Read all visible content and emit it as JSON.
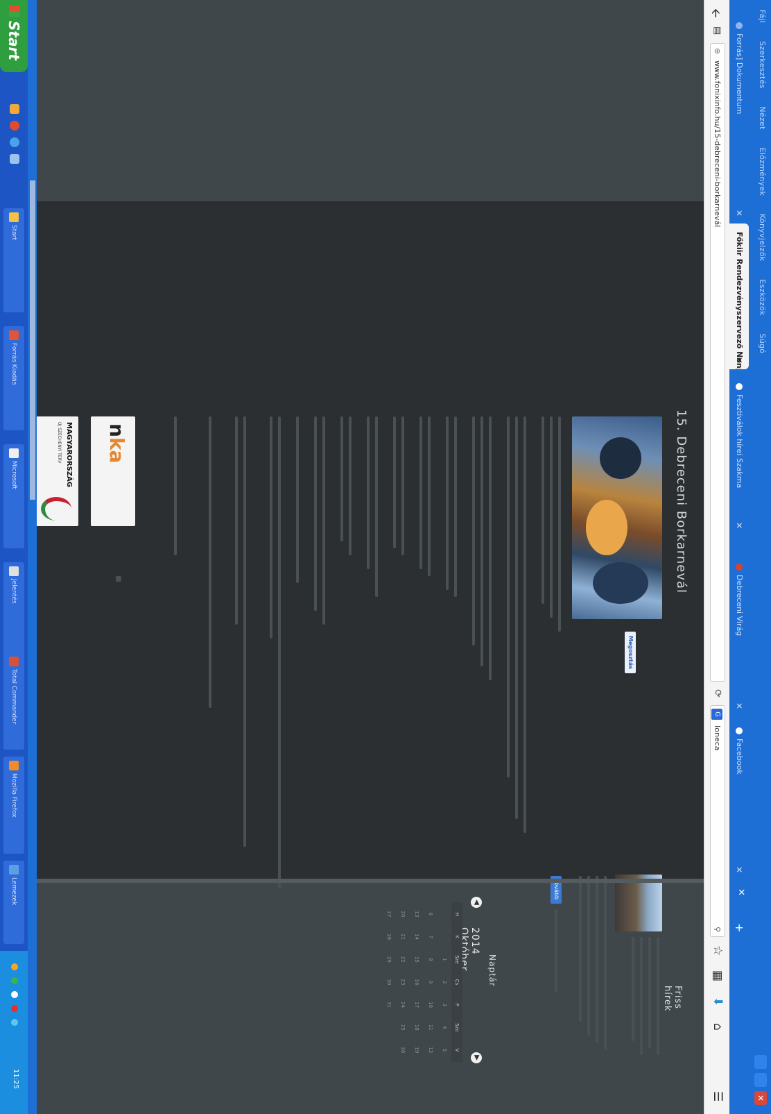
{
  "window": {
    "menu": [
      "Fájl",
      "Szerkesztés",
      "Nézet",
      "Előzmények",
      "Könyvjelzők",
      "Eszközök",
      "Súgó"
    ],
    "close_glyph": "✕"
  },
  "tabs": [
    {
      "label": "Forrás] Dokumentum",
      "active": false
    },
    {
      "label": "Főkiir Rendezvényszervező Nonpr...",
      "active": true
    },
    {
      "label": "Fesztiválok hírei Szakma",
      "active": false
    },
    {
      "label": "Debreceni Virág",
      "active": false
    },
    {
      "label": "Facebook",
      "active": false
    }
  ],
  "tab_close_glyph": "✕",
  "tab_new_glyph": "+",
  "tab_list_glyph": "✕",
  "toolbar": {
    "url": "www.fonixinfo.hu/15-debreceni-borkarnevál",
    "search_engine_badge": "G",
    "search_text": "Ioneca",
    "back_glyph": "🡨",
    "reload_glyph": "⟳"
  },
  "article": {
    "title": "15. Debreceni Borkarnevál",
    "share_label": "Megosztás"
  },
  "sidebar": {
    "title": "Friss hírek",
    "button_label": "Tovább"
  },
  "calendar": {
    "title": "Naptár",
    "month": "2014 Október",
    "weekdays": [
      "H",
      "K",
      "Sze",
      "Cs",
      "P",
      "Szo",
      "V"
    ],
    "weeks": [
      [
        "",
        "",
        "1",
        "2",
        "3",
        "4",
        "5"
      ],
      [
        "6",
        "7",
        "8",
        "9",
        "10",
        "11",
        "12"
      ],
      [
        "13",
        "14",
        "15",
        "16",
        "17",
        "18",
        "19"
      ],
      [
        "20",
        "21",
        "22",
        "23",
        "24",
        "25",
        "26"
      ],
      [
        "27",
        "28",
        "29",
        "30",
        "31",
        "",
        ""
      ]
    ]
  },
  "logos": {
    "nka_letters": "n",
    "nka_accent": "ka",
    "magyar_line1": "MAGYARORSZÁG",
    "magyar_line2": "ÚJ SZÉCHENYI TERV"
  },
  "taskbar": {
    "start_label": "Start",
    "tasks": [
      "Start",
      "Forrás Kiadás",
      "Microsoft",
      "Jelentés",
      "Total Commander",
      "Mozilla Firefox",
      "Lemezek"
    ],
    "clock": "11:25"
  },
  "colors": {
    "titlebar": "#1d6fd6",
    "taskbar": "#1d56c4",
    "start": "#2e9e3e",
    "page_bg": "#2b2f31",
    "accent_blue": "#3a7bd5"
  }
}
